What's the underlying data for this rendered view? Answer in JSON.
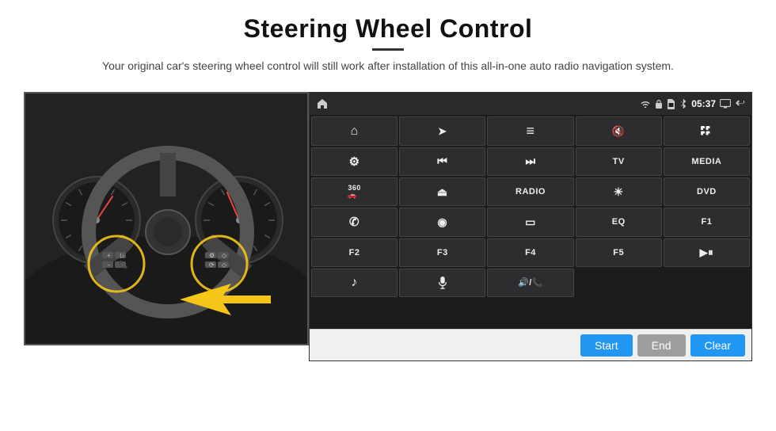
{
  "header": {
    "title": "Steering Wheel Control",
    "subtitle": "Your original car's steering wheel control will still work after installation of this all-in-one auto radio navigation system."
  },
  "status_bar": {
    "time": "05:37",
    "icons": [
      "wifi",
      "lock",
      "sim",
      "bluetooth",
      "battery",
      "screen",
      "back"
    ]
  },
  "grid_buttons": [
    {
      "id": "home",
      "type": "icon",
      "icon": "home"
    },
    {
      "id": "nav",
      "type": "icon",
      "icon": "nav"
    },
    {
      "id": "list",
      "type": "icon",
      "icon": "list"
    },
    {
      "id": "mute",
      "type": "icon",
      "icon": "mute"
    },
    {
      "id": "dots",
      "type": "icon",
      "icon": "dots"
    },
    {
      "id": "settings",
      "type": "icon",
      "icon": "settings"
    },
    {
      "id": "rewind",
      "type": "icon",
      "icon": "rewind"
    },
    {
      "id": "forward",
      "type": "icon",
      "icon": "forward"
    },
    {
      "id": "tv",
      "type": "text",
      "label": "TV"
    },
    {
      "id": "media",
      "type": "text",
      "label": "MEDIA"
    },
    {
      "id": "360cam",
      "type": "mixed",
      "label": "360"
    },
    {
      "id": "eject",
      "type": "icon",
      "icon": "eject"
    },
    {
      "id": "radio",
      "type": "text",
      "label": "RADIO"
    },
    {
      "id": "brightness",
      "type": "icon",
      "icon": "sun"
    },
    {
      "id": "dvd",
      "type": "text",
      "label": "DVD"
    },
    {
      "id": "phone",
      "type": "icon",
      "icon": "phone"
    },
    {
      "id": "map",
      "type": "icon",
      "icon": "circle"
    },
    {
      "id": "window",
      "type": "icon",
      "icon": "rect"
    },
    {
      "id": "eq",
      "type": "text",
      "label": "EQ"
    },
    {
      "id": "f1",
      "type": "text",
      "label": "F1"
    },
    {
      "id": "f2",
      "type": "text",
      "label": "F2"
    },
    {
      "id": "f3",
      "type": "text",
      "label": "F3"
    },
    {
      "id": "f4",
      "type": "text",
      "label": "F4"
    },
    {
      "id": "f5",
      "type": "text",
      "label": "F5"
    },
    {
      "id": "playpause",
      "type": "icon",
      "icon": "playpause"
    },
    {
      "id": "music",
      "type": "icon",
      "icon": "music"
    },
    {
      "id": "mic",
      "type": "icon",
      "icon": "mic"
    },
    {
      "id": "volphone",
      "type": "icon",
      "icon": "volphone"
    },
    {
      "id": "empty1",
      "type": "empty",
      "label": ""
    },
    {
      "id": "empty2",
      "type": "empty",
      "label": ""
    }
  ],
  "bottom_bar": {
    "start_label": "Start",
    "end_label": "End",
    "clear_label": "Clear"
  }
}
